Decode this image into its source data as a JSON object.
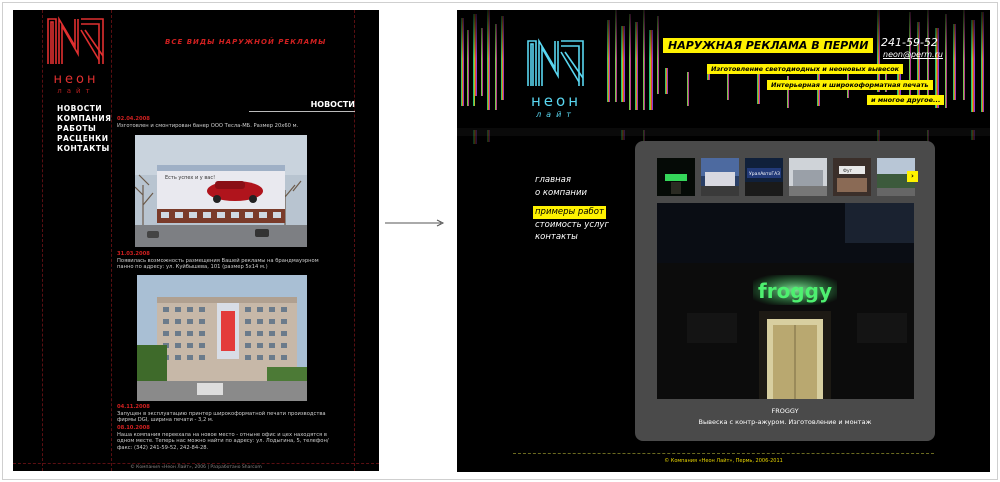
{
  "old_site": {
    "logo_word": "неон",
    "logo_word2": "лайт",
    "slogan": "ВСЕ ВИДЫ НАРУЖНОЙ РЕКЛАМЫ",
    "nav": [
      "НОВОСТИ",
      "КОМПАНИЯ",
      "РАБОТЫ",
      "РАСЦЕНКИ",
      "КОНТАКТЫ"
    ],
    "news_title": "НОВОСТИ",
    "news": [
      {
        "date": "02.04.2008",
        "text": "Изготовлен и смонтирован банер ООО Тесла-МБ. Размер 20х60 м."
      },
      {
        "date": "31.03.2008",
        "text": "Появилась возможность размещения Вашей рекламы на брандмауэрном панно по адресу: ул. Куйбышева, 101 (размер 5х14 м.)"
      },
      {
        "date": "04.11.2008",
        "text": "Запущен в эксплуатацию принтер широкоформатной печати производства фирмы DGI, ширина печати - 3,2 м."
      },
      {
        "date": "08.10.2008",
        "text": "Наша компания переехала на новое место - отныне офис и цех находятся в одном месте. Теперь нас можно найти по адресу: ул. Лодыгина, 5, телефон/факс: (342) 241-59-52, 242-84-28."
      }
    ],
    "billboard_text": "Есть успех и у вас!",
    "footer": "© Компания «Неон Лайт», 2006 | Разработано Sharcom"
  },
  "new_site": {
    "logo_word": "неон",
    "logo_word2": "лайт",
    "headline": "НАРУЖНАЯ РЕКЛАМА В ПЕРМИ",
    "phone": "241-59-52",
    "email": "neon@perm.ru",
    "tags": [
      "Изготовление светодиодных и неоновых вывесок",
      "Интерьерная и широкоформатная печать",
      "и многое другое..."
    ],
    "nav": [
      "главная",
      "о компании",
      "примеры работ",
      "стоимость услуг",
      "контакты"
    ],
    "active_nav_index": 2,
    "thumb_labels": [
      "",
      "",
      "УралАвтоГАЗ",
      "",
      "Фут",
      ""
    ],
    "next_glyph": "›",
    "photo_sign": "froggy",
    "caption_title": "FROGGY",
    "caption_text": "Вывеска с контр-ажуром. Изготовление и монтаж",
    "footer": "© Компания «Неон Лайт», Пермь, 2006-2011"
  },
  "colors": {
    "old_accent": "#d02020",
    "new_accent": "#fff200",
    "logo_cyan": "#59d6f0"
  }
}
